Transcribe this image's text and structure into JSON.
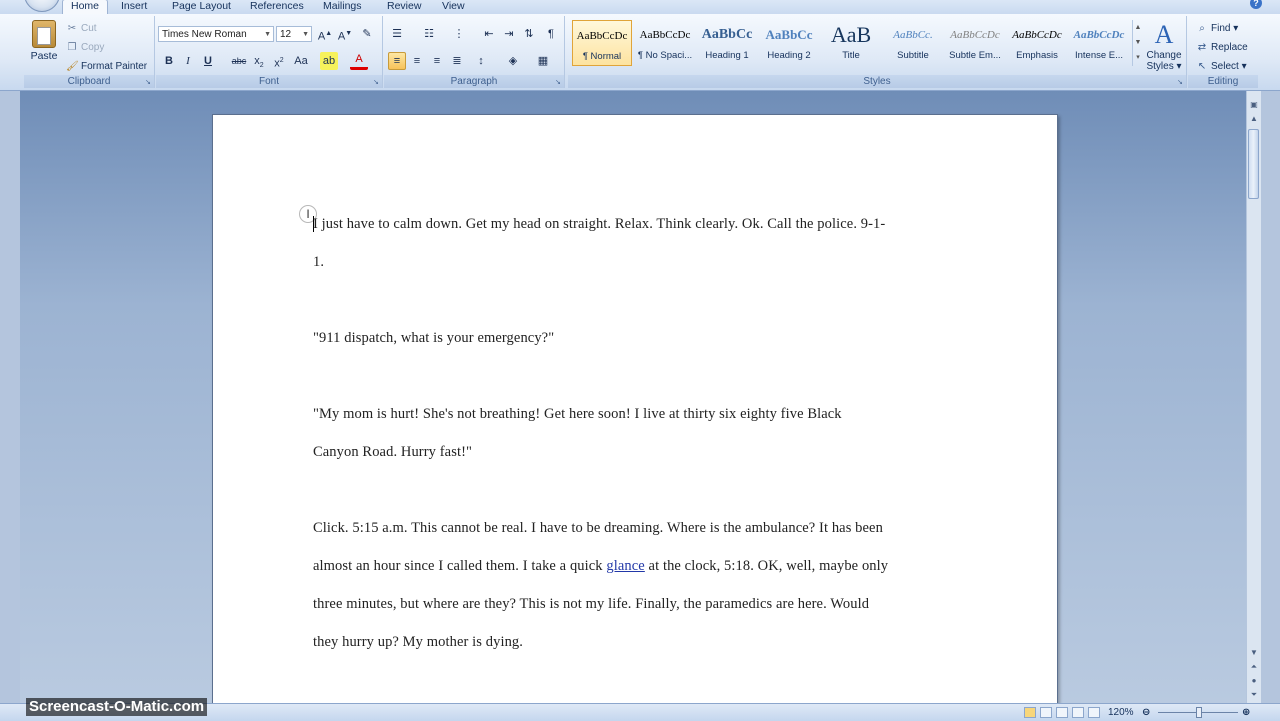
{
  "tabs": [
    "Home",
    "Insert",
    "Page Layout",
    "References",
    "Mailings",
    "Review",
    "View"
  ],
  "clipboard": {
    "paste": "Paste",
    "cut": "Cut",
    "copy": "Copy",
    "format_painter": "Format Painter",
    "group": "Clipboard"
  },
  "font": {
    "name": "Times New Roman",
    "size": "12",
    "group": "Font"
  },
  "paragraph": {
    "group": "Paragraph"
  },
  "styles": {
    "group": "Styles",
    "items": [
      {
        "sample": "AaBbCcDc",
        "name": "¶ Normal"
      },
      {
        "sample": "AaBbCcDc",
        "name": "¶ No Spaci..."
      },
      {
        "sample": "AaBbCc",
        "name": "Heading 1"
      },
      {
        "sample": "AaBbCc",
        "name": "Heading 2"
      },
      {
        "sample": "AaB",
        "name": "Title"
      },
      {
        "sample": "AaBbCc.",
        "name": "Subtitle"
      },
      {
        "sample": "AaBbCcDc",
        "name": "Subtle Em..."
      },
      {
        "sample": "AaBbCcDc",
        "name": "Emphasis"
      },
      {
        "sample": "AaBbCcDc",
        "name": "Intense E..."
      }
    ],
    "change_styles_line1": "Change",
    "change_styles_line2": "Styles"
  },
  "editing": {
    "find": "Find",
    "replace": "Replace",
    "select": "Select",
    "group": "Editing"
  },
  "document": {
    "p1": [
      "I just have to calm down. Get my head on straight. Relax. Think clearly. Ok. Call the police. 9-1-",
      "1."
    ],
    "p2": "\"911 dispatch, what is your emergency?\"",
    "p3": [
      "\"My mom is hurt! She's not breathing! Get here soon! I live at thirty six eighty five Black",
      "Canyon Road. Hurry fast!\""
    ],
    "p4_line1": "Click. 5:15 a.m. This cannot be real. I have to be dreaming. Where is the ambulance? It has been",
    "p4_line2_before": "almost an hour since I called them. I take a quick ",
    "p4_link": "glance",
    "p4_line2_after": " at the clock, 5:18. OK, well, maybe only",
    "p4_line3": "three minutes, but where are they? This is not my life. Finally, the paramedics are here. Would",
    "p4_line4": "they hurry up? My mother is dying."
  },
  "status": {
    "zoom": "120%"
  },
  "watermark": "Screencast-O-Matic.com"
}
